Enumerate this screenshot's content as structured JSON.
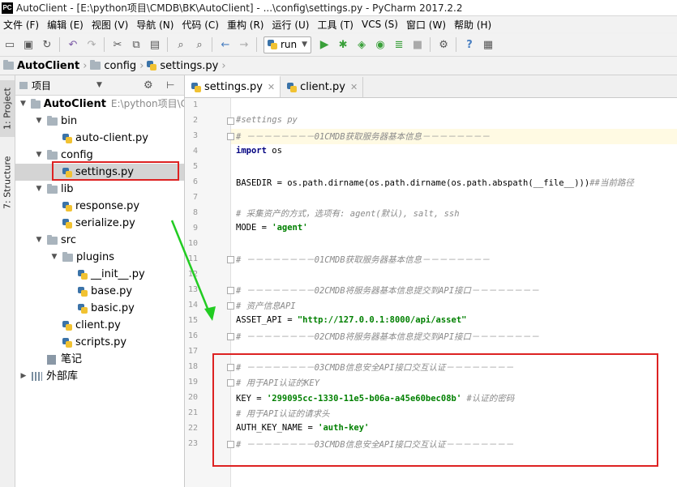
{
  "window": {
    "title": "AutoClient - [E:\\python项目\\CMDB\\BK\\AutoClient] - ...\\config\\settings.py - PyCharm 2017.2.2",
    "logo": "PC"
  },
  "menu": [
    "文件 (F)",
    "编辑 (E)",
    "视图 (V)",
    "导航 (N)",
    "代码 (C)",
    "重构 (R)",
    "运行 (U)",
    "工具 (T)",
    "VCS (S)",
    "窗口 (W)",
    "帮助 (H)"
  ],
  "toolbar": {
    "run_config": "run"
  },
  "breadcrumb": [
    "AutoClient",
    "config",
    "settings.py"
  ],
  "side_tabs": {
    "project": "1: Project",
    "structure": "7: Structure"
  },
  "project_panel": {
    "title": "项目",
    "root_name": "AutoClient",
    "root_path": "E:\\python项目\\C",
    "tree": [
      {
        "label": "bin",
        "type": "folder"
      },
      {
        "label": "auto-client.py",
        "type": "py"
      },
      {
        "label": "config",
        "type": "folder"
      },
      {
        "label": "settings.py",
        "type": "py"
      },
      {
        "label": "lib",
        "type": "folder"
      },
      {
        "label": "response.py",
        "type": "py"
      },
      {
        "label": "serialize.py",
        "type": "py"
      },
      {
        "label": "src",
        "type": "folder"
      },
      {
        "label": "plugins",
        "type": "folder"
      },
      {
        "label": "__init__.py",
        "type": "py"
      },
      {
        "label": "base.py",
        "type": "py"
      },
      {
        "label": "basic.py",
        "type": "py"
      },
      {
        "label": "client.py",
        "type": "py"
      },
      {
        "label": "scripts.py",
        "type": "py"
      },
      {
        "label": "笔记",
        "type": "note"
      },
      {
        "label": "外部库",
        "type": "lib"
      }
    ]
  },
  "editor": {
    "tabs": [
      {
        "label": "settings.py",
        "active": true
      },
      {
        "label": "client.py",
        "active": false
      }
    ],
    "lines": [
      {
        "n": "1",
        "parts": []
      },
      {
        "n": "2",
        "parts": [
          {
            "t": "#settings py",
            "c": "c-comment"
          }
        ]
      },
      {
        "n": "3",
        "parts": [
          {
            "t": "# －－－－－－－－01CMDB获取服务器基本信息－－－－－－－－",
            "c": "c-comment"
          }
        ]
      },
      {
        "n": "4",
        "parts": [
          {
            "t": "import",
            "c": "c-keyword"
          },
          {
            "t": " os",
            "c": "c-plain"
          }
        ]
      },
      {
        "n": "5",
        "parts": []
      },
      {
        "n": "6",
        "parts": [
          {
            "t": "BASEDIR = os.path.dirname(os.path.dirname(os.path.abspath(__file__)))",
            "c": "c-plain"
          },
          {
            "t": "##当前路径",
            "c": "c-comment"
          }
        ]
      },
      {
        "n": "7",
        "parts": []
      },
      {
        "n": "8",
        "parts": [
          {
            "t": "# 采集资产的方式，选项有: agent(默认), salt, ssh",
            "c": "c-comment"
          }
        ]
      },
      {
        "n": "9",
        "parts": [
          {
            "t": "MODE = ",
            "c": "c-plain"
          },
          {
            "t": "'agent'",
            "c": "c-string"
          }
        ]
      },
      {
        "n": "10",
        "parts": []
      },
      {
        "n": "11",
        "parts": [
          {
            "t": "# －－－－－－－－01CMDB获取服务器基本信息－－－－－－－－",
            "c": "c-comment"
          }
        ]
      },
      {
        "n": "12",
        "parts": []
      },
      {
        "n": "13",
        "parts": [
          {
            "t": "# －－－－－－－－02CMDB将服务器基本信息提交到API接口－－－－－－－－",
            "c": "c-comment"
          }
        ]
      },
      {
        "n": "14",
        "parts": [
          {
            "t": "# 资产信息API",
            "c": "c-comment"
          }
        ]
      },
      {
        "n": "15",
        "parts": [
          {
            "t": "ASSET_API = ",
            "c": "c-plain"
          },
          {
            "t": "\"http://127.0.0.1:8000/api/asset\"",
            "c": "c-string"
          }
        ]
      },
      {
        "n": "16",
        "parts": [
          {
            "t": "# －－－－－－－－02CMDB将服务器基本信息提交到API接口－－－－－－－－",
            "c": "c-comment"
          }
        ]
      },
      {
        "n": "17",
        "parts": []
      },
      {
        "n": "18",
        "parts": [
          {
            "t": "# －－－－－－－－03CMDB信息安全API接口交互认证－－－－－－－－",
            "c": "c-comment"
          }
        ]
      },
      {
        "n": "19",
        "parts": [
          {
            "t": "# 用于API认证的KEY",
            "c": "c-comment"
          }
        ]
      },
      {
        "n": "20",
        "parts": [
          {
            "t": "KEY = ",
            "c": "c-plain"
          },
          {
            "t": "'299095cc-1330-11e5-b06a-a45e60bec08b'",
            "c": "c-string"
          },
          {
            "t": " #认证的密码",
            "c": "c-comment"
          }
        ]
      },
      {
        "n": "21",
        "parts": [
          {
            "t": "# 用于API认证的请求头",
            "c": "c-comment"
          }
        ]
      },
      {
        "n": "22",
        "parts": [
          {
            "t": "AUTH_KEY_NAME = ",
            "c": "c-plain"
          },
          {
            "t": "'auth-key'",
            "c": "c-string"
          }
        ]
      },
      {
        "n": "23",
        "parts": [
          {
            "t": "# －－－－－－－－03CMDB信息安全API接口交互认证－－－－－－－－",
            "c": "c-comment"
          }
        ]
      }
    ]
  },
  "colors": {
    "annotation": "#dd2222",
    "arrow": "#22cc22"
  }
}
